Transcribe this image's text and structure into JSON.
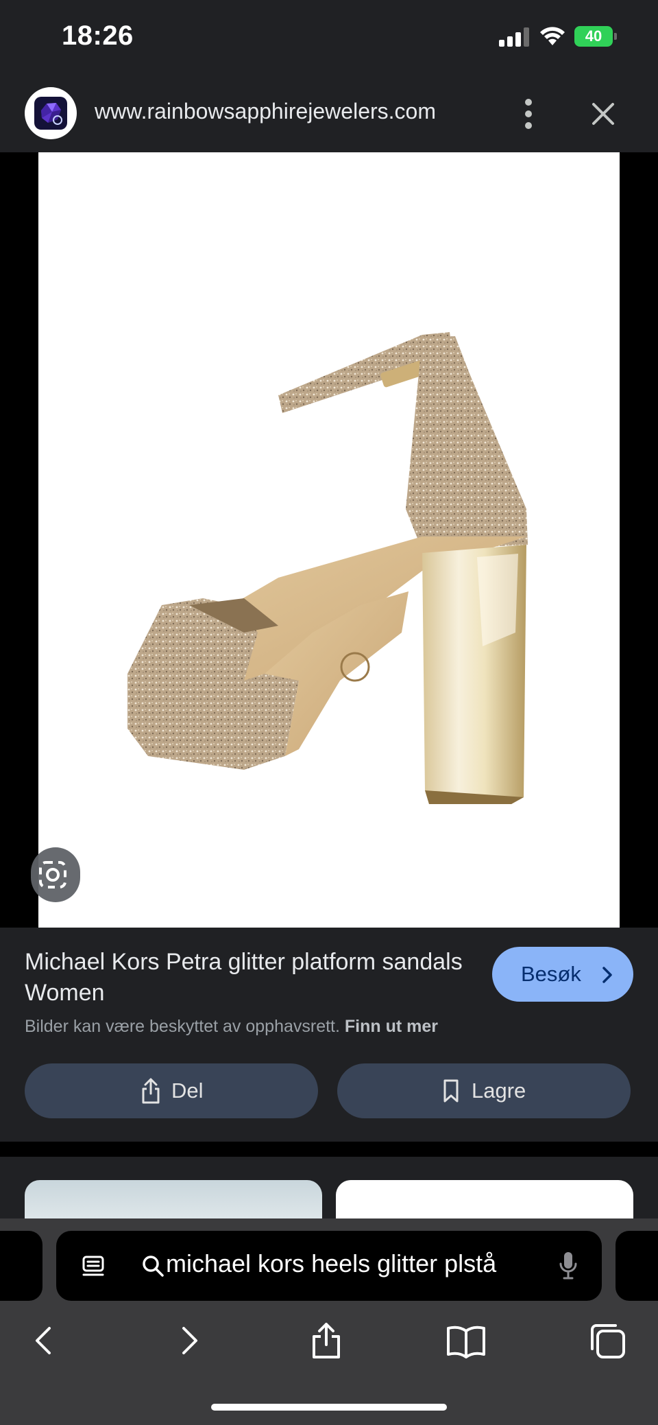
{
  "status_bar": {
    "time": "18:26",
    "battery": "40",
    "battery_color": "#30d158"
  },
  "browser": {
    "url": "www.rainbowsapphirejewelers.com",
    "favicon": "gem-icon",
    "menu_icon": "more-vert-icon",
    "close_icon": "close-icon"
  },
  "viewer": {
    "image": "glitter-platform-sandal-image",
    "lens_icon": "lens-search-icon"
  },
  "result": {
    "title": "Michael Kors Petra glitter platform sandals Women",
    "visit_label": "Besøk",
    "copyright_text": "Bilder kan være beskyttet av opphavsrett.",
    "learn_more": "Finn ut mer",
    "share_label": "Del",
    "save_label": "Lagre",
    "accent_color": "#8ab4f8"
  },
  "address_bar": {
    "query": "michael kors heels glitter plstå",
    "reader_icon": "reader-icon",
    "search_icon": "search-icon",
    "mic_icon": "microphone-icon"
  },
  "toolbar": {
    "items": [
      "back-icon",
      "forward-icon",
      "share-icon",
      "bookmarks-icon",
      "tabs-icon"
    ]
  }
}
